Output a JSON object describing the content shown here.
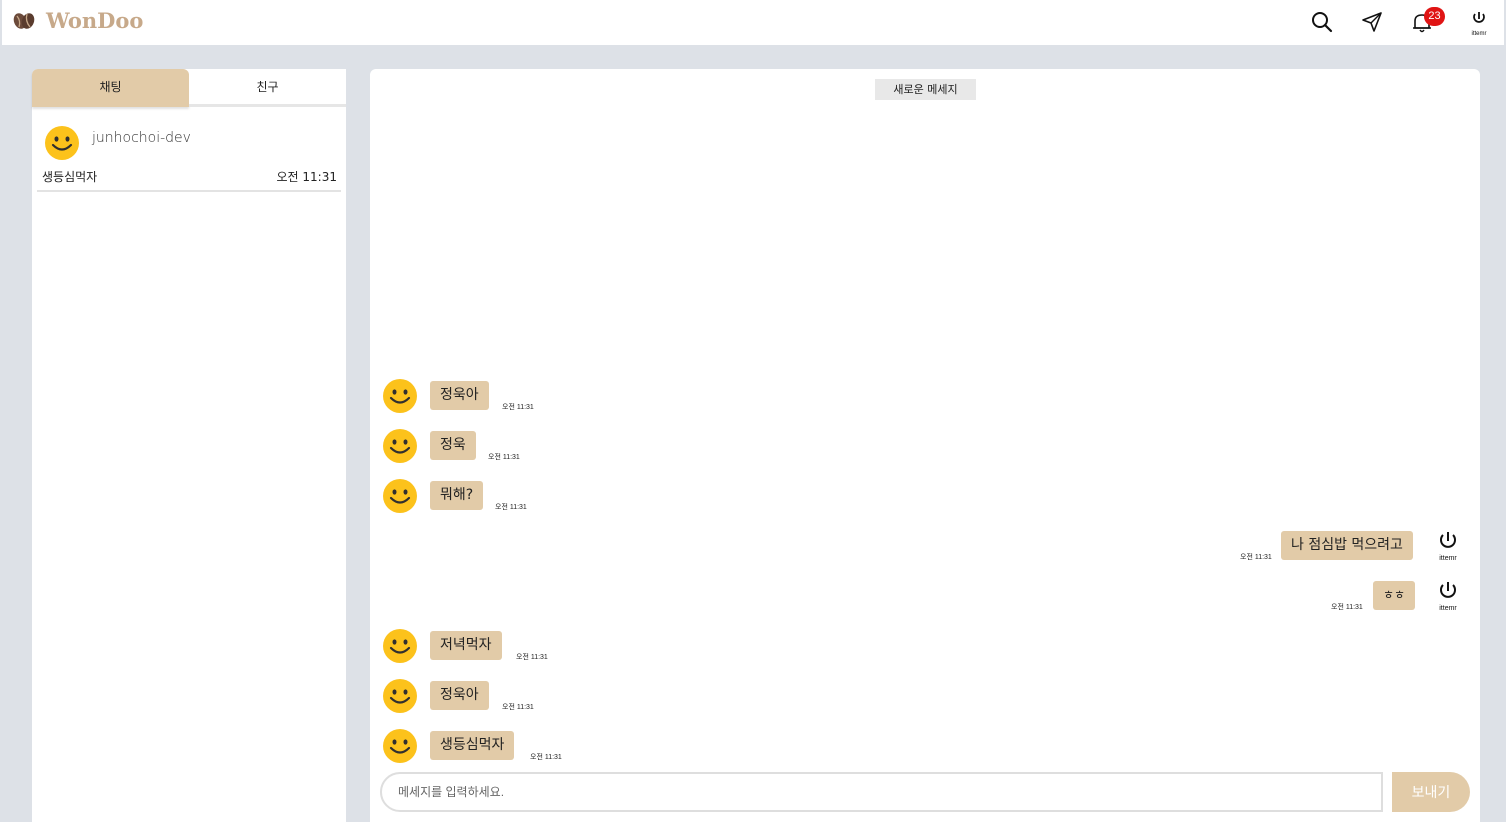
{
  "header": {
    "brand": "WonDoo",
    "icons": [
      "coffee-bean-icon",
      "search-icon",
      "send-icon",
      "bell-icon",
      "user-avatar"
    ],
    "notification_count": "23",
    "avatar_text": "ittemr"
  },
  "sidebar": {
    "tabs": [
      {
        "label": "채팅",
        "active": true
      },
      {
        "label": "친구",
        "active": false
      }
    ],
    "rooms": [
      {
        "name": "junhochoi-dev",
        "last_message": "생등심먹자",
        "time": "오전 11:31"
      }
    ]
  },
  "chat": {
    "new_messages_label": "새로운 메세지",
    "messages": [
      {
        "from": "other",
        "text": "정욱아",
        "time": "오전 11:31"
      },
      {
        "from": "other",
        "text": "정욱",
        "time": "오전 11:31"
      },
      {
        "from": "other",
        "text": "뭐해?",
        "time": "오전 11:31"
      },
      {
        "from": "me",
        "text": "나 점심밥 먹으려고",
        "time": "오전 11:31"
      },
      {
        "from": "me",
        "text": "ㅎㅎ",
        "time": "오전 11:31"
      },
      {
        "from": "other",
        "text": "저녁먹자",
        "time": "오전 11:31"
      },
      {
        "from": "other",
        "text": "정욱아",
        "time": "오전 11:31"
      },
      {
        "from": "other",
        "text": "생등심먹자",
        "time": "오전 11:31"
      }
    ],
    "input_placeholder": "메세지를 입력하세요.",
    "send_label": "보내기"
  },
  "colors": {
    "accent": "#e2cba8",
    "brand": "#c7a98a",
    "background": "#dde1e7",
    "badge": "#e01414"
  }
}
